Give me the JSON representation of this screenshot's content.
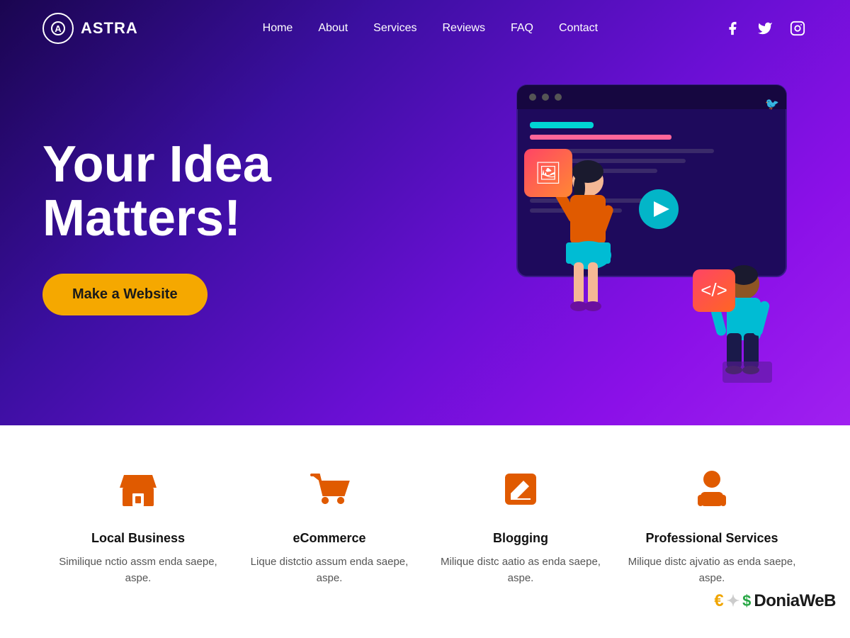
{
  "header": {
    "logo_text": "ASTRA",
    "nav_items": [
      {
        "label": "Home",
        "href": "#"
      },
      {
        "label": "About",
        "href": "#"
      },
      {
        "label": "Services",
        "href": "#"
      },
      {
        "label": "Reviews",
        "href": "#"
      },
      {
        "label": "FAQ",
        "href": "#"
      },
      {
        "label": "Contact",
        "href": "#"
      }
    ],
    "social": [
      {
        "name": "facebook",
        "symbol": "f"
      },
      {
        "name": "twitter",
        "symbol": "t"
      },
      {
        "name": "instagram",
        "symbol": "i"
      }
    ]
  },
  "hero": {
    "title_line1": "Your Idea",
    "title_line2": "Matters!",
    "cta_label": "Make a Website"
  },
  "services": [
    {
      "icon": "store",
      "title": "Local Business",
      "description": "Similique nctio assm enda saepe, aspe."
    },
    {
      "icon": "cart",
      "title": "eCommerce",
      "description": "Lique distctio assum enda saepe, aspe."
    },
    {
      "icon": "edit",
      "title": "Blogging",
      "description": "Milique distc aatio as enda saepe, aspe."
    },
    {
      "icon": "person",
      "title": "Professional Services",
      "description": "Milique distc ajvatio as enda saepe, aspe."
    }
  ],
  "watermark": {
    "text": "DoniaWeB"
  },
  "colors": {
    "orange": "#e05a00",
    "hero_gradient_start": "#1a0550",
    "hero_gradient_end": "#a020f0",
    "cta_bg": "#f5a800"
  }
}
